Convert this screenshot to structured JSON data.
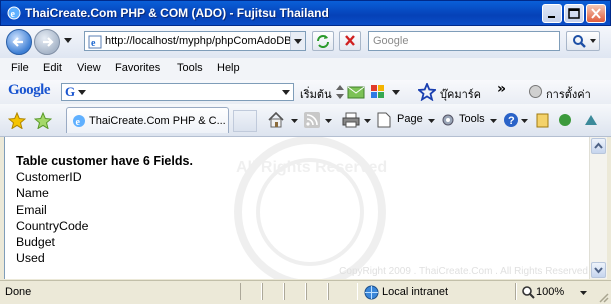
{
  "window": {
    "title": "ThaiCreate.Com PHP & COM (ADO) - Fujitsu Thailand"
  },
  "address_bar": {
    "url": "http://localhost/myphp/phpComAdoDB",
    "search_placeholder": "Google"
  },
  "menu": [
    "File",
    "Edit",
    "View",
    "Favorites",
    "Tools",
    "Help"
  ],
  "google_toolbar": {
    "logo": "Google",
    "logo_g": "G",
    "start_label": "เริ่มต้น",
    "bookmarks_label": "บุ๊คมาร์ค",
    "more": "»",
    "settings_label": "การตั้งค่า"
  },
  "tabs": {
    "active_label": "ThaiCreate.Com PHP & C..."
  },
  "command_bar": {
    "page_label": "Page",
    "tools_label": "Tools"
  },
  "content": {
    "heading": "Table customer have 6 Fields.",
    "fields": [
      "CustomerID",
      "Name",
      "Email",
      "CountryCode",
      "Budget",
      "Used"
    ],
    "watermark_text": "All Rights Reserved",
    "copyright": "CopyRight 2009 . ThaiCreate.Com . All Rights Reserved"
  },
  "status": {
    "text": "Done",
    "zone": "Local intranet",
    "zoom": "100%"
  },
  "colors": {
    "titlebar": "#0541b7",
    "content_bg": "#ffffff",
    "chrome": "#ece9d8"
  }
}
